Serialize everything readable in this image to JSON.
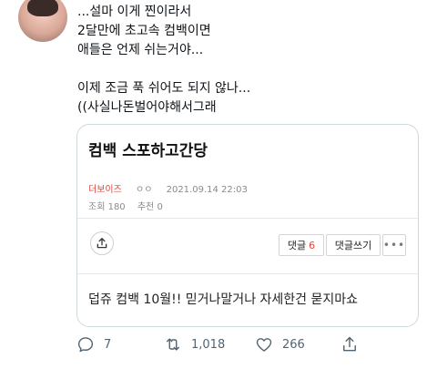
{
  "tweet": {
    "lines": [
      "...설마 이게 찐이라서",
      "2달만에 초고속 컴백이면",
      "애들은 언제 쉬는거야...",
      "",
      "이제 조금 푹 쉬어도 되지 않나...",
      "((사실나돈벌어야해서그래"
    ]
  },
  "card": {
    "title": "컴백 스포하고간당",
    "author": "더보이즈",
    "mark": "ㅇㅇ",
    "datetime": "2021.09.14 22:03",
    "views": "조회 180",
    "recommend": "추천 0",
    "comment_label": "댓글",
    "comment_count": "6",
    "write_comment": "댓글쓰기",
    "more": "•••",
    "body": "덥쥬 컴백 10월!! 믿거나말거나 자세한건 묻지마쇼"
  },
  "actions": {
    "replies": "7",
    "retweets": "1,018",
    "likes": "266"
  },
  "icons": {
    "reply": "reply-icon",
    "retweet": "retweet-icon",
    "like": "heart-icon",
    "share": "share-icon",
    "card_share": "share-icon"
  },
  "colors": {
    "text": "#0f1419",
    "muted": "#536471",
    "accent_red": "#e0453a",
    "border": "#cfd9de"
  }
}
